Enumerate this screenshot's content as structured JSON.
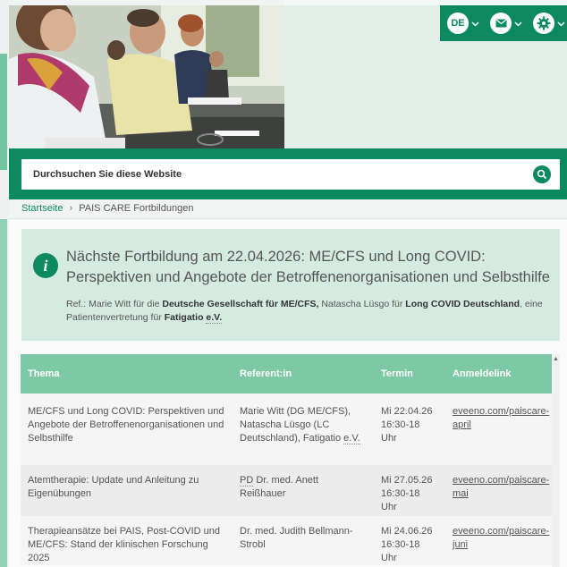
{
  "toolbar": {
    "language": "DE"
  },
  "search": {
    "placeholder": "Durchsuchen Sie diese Website"
  },
  "breadcrumb": {
    "home": "Startseite",
    "separator": "›",
    "current": "PAIS CARE Fortbildungen"
  },
  "info": {
    "icon_letter": "i",
    "title": "Nächste Fortbildung am 22.04.2026: ME/CFS und Long COVID: Perspektiven und Angebote der Betroffenenorganisationen und Selbsthilfe",
    "ref_1": "Ref.: Marie Witt für die ",
    "ref_org_1": "Deutsche Gesellschaft für ME/CFS,",
    "ref_2": " Natascha Lüsgo für ",
    "ref_org_2": "Long COVID Deutschland",
    "ref_3": ", eine Patientenvertretung für ",
    "ref_org_3a": "Fatigatio ",
    "ref_org_3b": "e.V."
  },
  "table": {
    "headers": [
      "Thema",
      "Referent:in",
      "Termin",
      "Anmeldelink"
    ],
    "rows": [
      {
        "thema": "ME/CFS und Long COVID: Perspektiven und Angebote der Betroffenenorganisationen und Selbsthilfe",
        "referent_a": "Marie Witt (DG ME/CFS), Natascha Lüsgo (LC Deutschland), Fatigatio ",
        "referent_b": "e.V.",
        "termin_date": "Mi 22.04.26",
        "termin_time": "16:30-18 Uhr",
        "link": "eveeno.com/paiscare-april"
      },
      {
        "referent_a": "PD",
        "referent_b": " Dr. med. Anett Reißhauer",
        "thema": "Atemtherapie: Update und Anleitung zu Eigenübungen",
        "termin_date": "Mi 27.05.26",
        "termin_time": "16:30-18 Uhr",
        "link": "eveeno.com/paiscare-mai"
      },
      {
        "thema": "Therapieansätze bei PAIS, Post-COVID und ME/CFS: Stand der klinischen Forschung 2025",
        "referent_a": "Dr. med. Judith Bellmann-Strobl",
        "termin_date": "Mi 24.06.26",
        "termin_time": "16:30-18 Uhr",
        "link": "eveeno.com/paiscare-juni"
      }
    ]
  },
  "colors": {
    "brand_green": "#0c8a5f",
    "header_green": "#7dc9a5",
    "info_bg": "#d5ebe1"
  },
  "icons": {
    "mail": "mail-icon",
    "settings": "gear-icon",
    "search": "search-icon",
    "info": "info-icon"
  }
}
